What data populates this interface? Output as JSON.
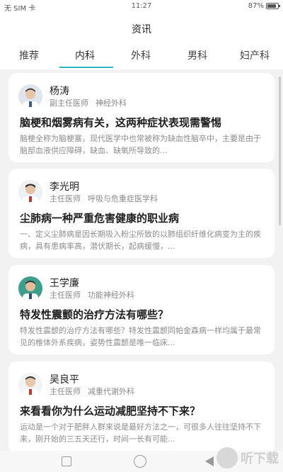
{
  "status_bar": {
    "carrier": "无 SIM 卡",
    "time": "11:27",
    "battery": "87%"
  },
  "header": {
    "title": "资讯"
  },
  "tabs": [
    {
      "label": "推荐"
    },
    {
      "label": "内科"
    },
    {
      "label": "外科"
    },
    {
      "label": "男科"
    },
    {
      "label": "妇产科"
    }
  ],
  "active_tab": "内科",
  "articles": [
    {
      "doctor": "杨涛",
      "position": "副主任医师",
      "department": "神经外科",
      "title": "脑梗和烟雾病有关，这两种症状表现需警惕",
      "summary": "脑梗全称为脑梗塞，现代医学中也常被称为缺血性脑卒中，主要是由于脑部血液供应障碍，缺血、缺氧所导致的..."
    },
    {
      "doctor": "李光明",
      "position": "主任医师",
      "department": "呼吸与危重症医学科",
      "title": "尘肺病一种严重危害健康的职业病",
      "summary": "一、定义尘肺病是因长期吸入粉尘所致的以肺组织纤维化病变为主的疾病，具有患病率高，潜伏期长，起病缓慢，..."
    },
    {
      "doctor": "王学廉",
      "position": "主任医师",
      "department": "功能神经外科",
      "title": "特发性震颤的治疗方法有哪些？",
      "summary": "特发性震颤的治疗方法有哪些？特发性震颤同帕金森病一样均属于最常见的椎体外系疾病，姿势性震颤是唯一临床..."
    },
    {
      "doctor": "吴良平",
      "position": "主任医师",
      "department": "减重代谢外科",
      "title": "来看看你为什么运动减肥坚持不下来？",
      "summary": "运动是一个对于肥胖人群来说是最好方法之一，可很多人往往坚持不下来，刚开始的三五天还行，时间一长有可能..."
    }
  ],
  "watermark": {
    "text": "听下载"
  },
  "colors": {
    "accent": "#2bb5c2"
  }
}
